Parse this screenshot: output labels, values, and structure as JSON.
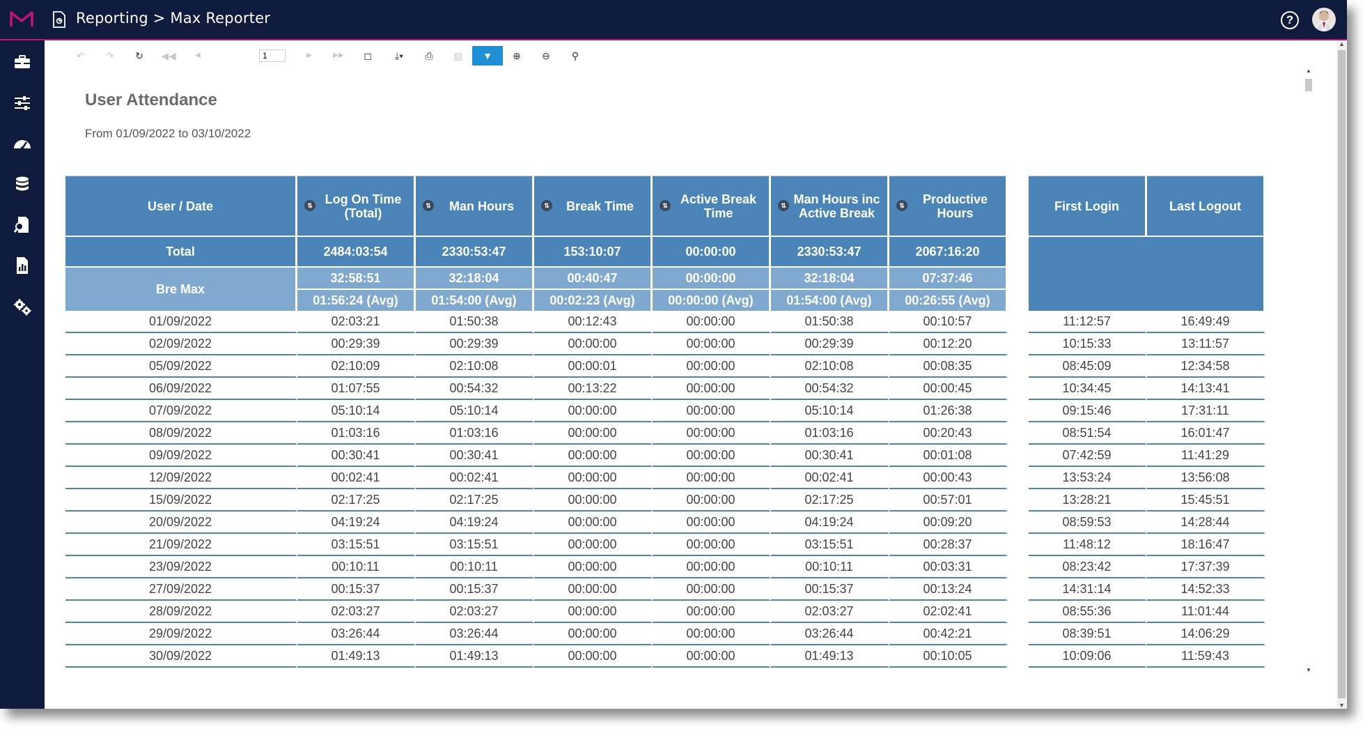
{
  "app": {
    "breadcrumb": "Reporting > Max Reporter",
    "help_label": "?"
  },
  "sidebar": [
    {
      "icon": "briefcase-icon",
      "label": ""
    },
    {
      "icon": "sliders-icon",
      "label": ""
    },
    {
      "icon": "dashboard-icon",
      "label": ""
    },
    {
      "icon": "database-icon",
      "label": ""
    },
    {
      "icon": "search-document-icon",
      "label": ""
    },
    {
      "icon": "report-chart-icon",
      "label": ""
    },
    {
      "icon": "settings-gears-icon",
      "label": ""
    }
  ],
  "toolbar": {
    "page_number": "1",
    "buttons": [
      "back-icon",
      "forward-icon",
      "refresh-icon",
      "first-page-icon",
      "prev-page-icon",
      "next-page-icon",
      "last-page-icon",
      "print-layout-icon",
      "export-icon",
      "print-icon",
      "document-map-icon",
      "filter-icon",
      "zoom-in-icon",
      "zoom-out-icon",
      "find-icon"
    ]
  },
  "report": {
    "title": "User Attendance",
    "subtitle": "From 01/09/2022 to 03/10/2022",
    "columns": [
      "User / Date",
      "Log On Time (Total)",
      "Man Hours",
      "Break Time",
      "Active Break Time",
      "Man Hours inc Active Break",
      "Productive Hours"
    ],
    "columns_right": [
      "First Login",
      "Last Logout"
    ],
    "total": {
      "label": "Total",
      "values": [
        "2484:03:54",
        "2330:53:47",
        "153:10:07",
        "00:00:00",
        "2330:53:47",
        "2067:16:20"
      ]
    },
    "user": {
      "name": "Bre Max",
      "totals": [
        "32:58:51",
        "32:18:04",
        "00:40:47",
        "00:00:00",
        "32:18:04",
        "07:37:46"
      ],
      "avgs": [
        "01:56:24 (Avg)",
        "01:54:00 (Avg)",
        "00:02:23 (Avg)",
        "00:00:00 (Avg)",
        "01:54:00 (Avg)",
        "00:26:55 (Avg)"
      ]
    },
    "rows": [
      {
        "date": "01/09/2022",
        "v": [
          "02:03:21",
          "01:50:38",
          "00:12:43",
          "00:00:00",
          "01:50:38",
          "00:10:57"
        ],
        "first": "11:12:57",
        "last": "16:49:49"
      },
      {
        "date": "02/09/2022",
        "v": [
          "00:29:39",
          "00:29:39",
          "00:00:00",
          "00:00:00",
          "00:29:39",
          "00:12:20"
        ],
        "first": "10:15:33",
        "last": "13:11:57"
      },
      {
        "date": "05/09/2022",
        "v": [
          "02:10:09",
          "02:10:08",
          "00:00:01",
          "00:00:00",
          "02:10:08",
          "00:08:35"
        ],
        "first": "08:45:09",
        "last": "12:34:58"
      },
      {
        "date": "06/09/2022",
        "v": [
          "01:07:55",
          "00:54:32",
          "00:13:22",
          "00:00:00",
          "00:54:32",
          "00:00:45"
        ],
        "first": "10:34:45",
        "last": "14:13:41"
      },
      {
        "date": "07/09/2022",
        "v": [
          "05:10:14",
          "05:10:14",
          "00:00:00",
          "00:00:00",
          "05:10:14",
          "01:26:38"
        ],
        "first": "09:15:46",
        "last": "17:31:11"
      },
      {
        "date": "08/09/2022",
        "v": [
          "01:03:16",
          "01:03:16",
          "00:00:00",
          "00:00:00",
          "01:03:16",
          "00:20:43"
        ],
        "first": "08:51:54",
        "last": "16:01:47"
      },
      {
        "date": "09/09/2022",
        "v": [
          "00:30:41",
          "00:30:41",
          "00:00:00",
          "00:00:00",
          "00:30:41",
          "00:01:08"
        ],
        "first": "07:42:59",
        "last": "11:41:29"
      },
      {
        "date": "12/09/2022",
        "v": [
          "00:02:41",
          "00:02:41",
          "00:00:00",
          "00:00:00",
          "00:02:41",
          "00:00:43"
        ],
        "first": "13:53:24",
        "last": "13:56:08"
      },
      {
        "date": "15/09/2022",
        "v": [
          "02:17:25",
          "02:17:25",
          "00:00:00",
          "00:00:00",
          "02:17:25",
          "00:57:01"
        ],
        "first": "13:28:21",
        "last": "15:45:51"
      },
      {
        "date": "20/09/2022",
        "v": [
          "04:19:24",
          "04:19:24",
          "00:00:00",
          "00:00:00",
          "04:19:24",
          "00:09:20"
        ],
        "first": "08:59:53",
        "last": "14:28:44"
      },
      {
        "date": "21/09/2022",
        "v": [
          "03:15:51",
          "03:15:51",
          "00:00:00",
          "00:00:00",
          "03:15:51",
          "00:28:37"
        ],
        "first": "11:48:12",
        "last": "18:16:47"
      },
      {
        "date": "23/09/2022",
        "v": [
          "00:10:11",
          "00:10:11",
          "00:00:00",
          "00:00:00",
          "00:10:11",
          "00:03:31"
        ],
        "first": "08:23:42",
        "last": "17:37:39"
      },
      {
        "date": "27/09/2022",
        "v": [
          "00:15:37",
          "00:15:37",
          "00:00:00",
          "00:00:00",
          "00:15:37",
          "00:13:24"
        ],
        "first": "14:31:14",
        "last": "14:52:33"
      },
      {
        "date": "28/09/2022",
        "v": [
          "02:03:27",
          "02:03:27",
          "00:00:00",
          "00:00:00",
          "02:03:27",
          "02:02:41"
        ],
        "first": "08:55:36",
        "last": "11:01:44"
      },
      {
        "date": "29/09/2022",
        "v": [
          "03:26:44",
          "03:26:44",
          "00:00:00",
          "00:00:00",
          "03:26:44",
          "00:42:21"
        ],
        "first": "08:39:51",
        "last": "14:06:29"
      },
      {
        "date": "30/09/2022",
        "v": [
          "01:49:13",
          "01:49:13",
          "00:00:00",
          "00:00:00",
          "01:49:13",
          "00:10:05"
        ],
        "first": "10:09:06",
        "last": "11:59:43"
      }
    ]
  },
  "colors": {
    "nav_bg": "#0f1b3d",
    "accent_line": "#c4137a",
    "header_blue": "#4a84b8",
    "group_blue": "#7fa9cf",
    "filter_active": "#1e8fd6"
  }
}
